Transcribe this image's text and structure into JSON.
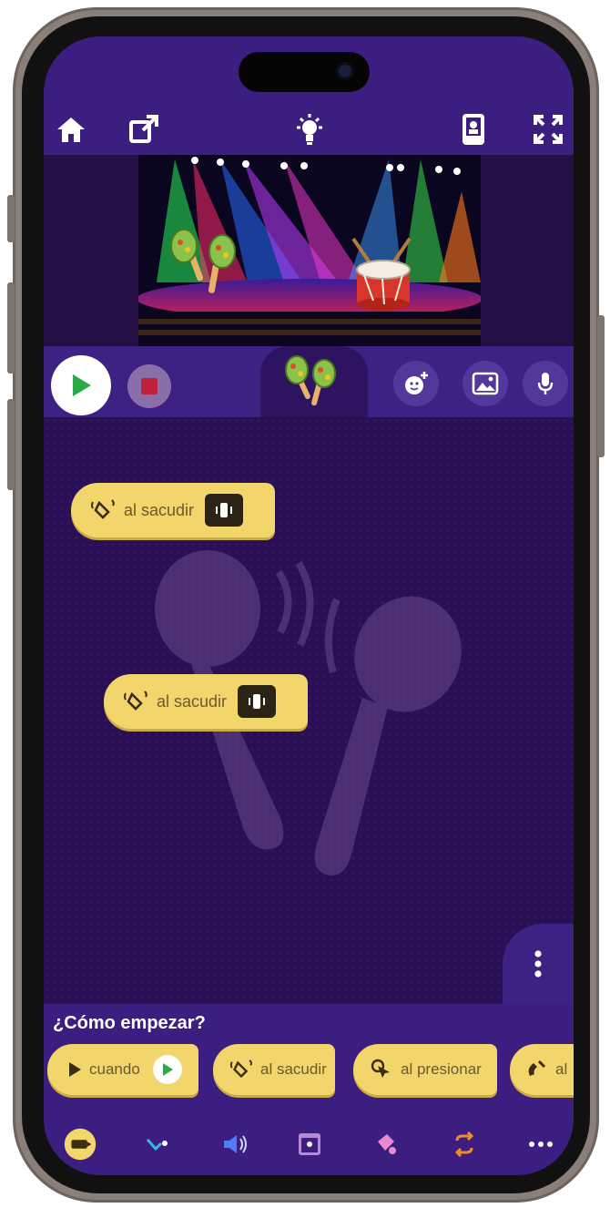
{
  "toolbar": {
    "home_icon": "home-icon",
    "share_icon": "share-icon",
    "hint_icon": "lightbulb-icon",
    "device_icon": "phone-preview-icon",
    "fullscreen_icon": "fullscreen-icon"
  },
  "stage": {
    "scene": "concert-stage",
    "sprites": [
      "maracas",
      "drum"
    ]
  },
  "controls": {
    "play_icon": "play-icon",
    "stop_icon": "stop-icon",
    "selected_sprite": "maracas",
    "add_sprite_icon": "add-character-icon",
    "background_icon": "image-icon",
    "sound_icon": "microphone-icon"
  },
  "canvas": {
    "blocks": [
      {
        "label": "al sacudir",
        "icon": "shake-icon",
        "badge_icon": "vibrate-icon"
      },
      {
        "label": "al sacudir",
        "icon": "shake-icon",
        "badge_icon": "vibrate-icon"
      }
    ],
    "background_icon": "maracas-watermark-icon",
    "menu_icon": "more-vertical-icon"
  },
  "bottom": {
    "howto_title": "¿Cómo empezar?",
    "palette": [
      {
        "label": "cuando",
        "icon": "play-icon"
      },
      {
        "label": "al sacudir",
        "icon": "shake-icon"
      },
      {
        "label": "al presionar",
        "icon": "press-icon"
      },
      {
        "label": "al",
        "icon": "magnet-icon"
      }
    ],
    "categories": [
      {
        "name": "events-icon",
        "active": true
      },
      {
        "name": "motion-icon",
        "active": false
      },
      {
        "name": "sound-icon",
        "active": false
      },
      {
        "name": "looks-icon",
        "active": false
      },
      {
        "name": "paint-icon",
        "active": false
      },
      {
        "name": "control-icon",
        "active": false
      },
      {
        "name": "more-icon",
        "active": false
      }
    ]
  },
  "colors": {
    "background": "#2a0f57",
    "bar": "#3b1e80",
    "block": "#f2d56b",
    "play_green": "#2aa84a",
    "stop_red": "#c0203a"
  }
}
